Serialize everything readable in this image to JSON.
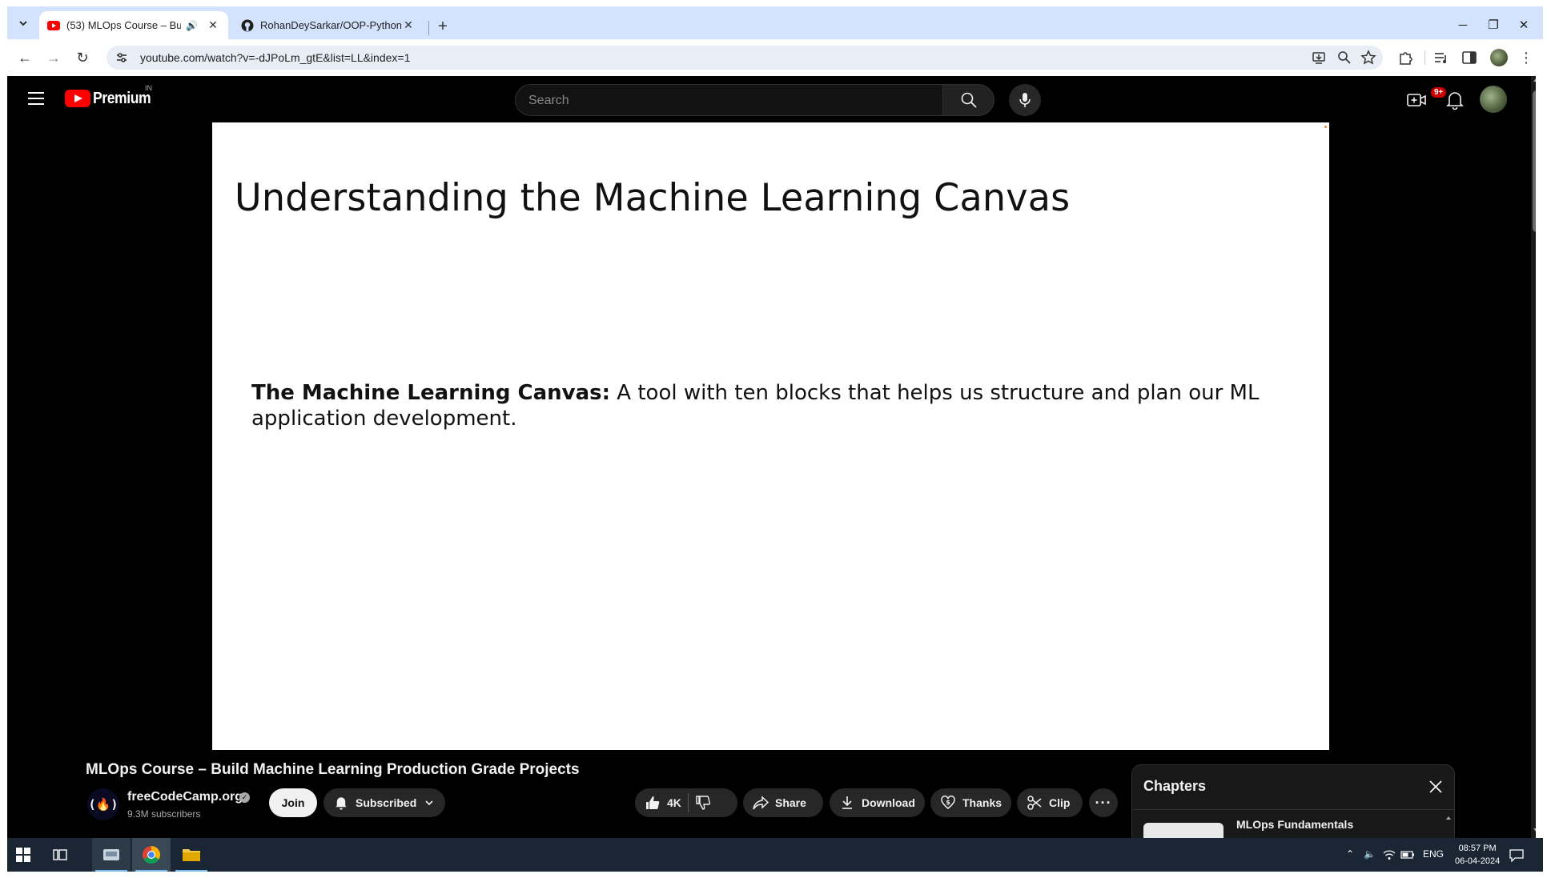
{
  "browser": {
    "tabs": [
      {
        "title": "(53) MLOps Course – Build Machine Learning Production Grade Projects",
        "active": true
      },
      {
        "title": "RohanDeySarkar/OOP-Python",
        "active": false
      }
    ],
    "url": "youtube.com/watch?v=-dJPoLm_gtE&list=LL&index=1"
  },
  "youtube": {
    "logo_text": "Premium",
    "region": "IN",
    "search_placeholder": "Search",
    "notification_badge": "9+",
    "video_title": "MLOps Course – Build Machine Learning Production Grade Projects",
    "channel": {
      "name": "freeCodeCamp.org",
      "subscribers": "9.3M subscribers",
      "logo_glyph": "(🔥)"
    },
    "buttons": {
      "join": "Join",
      "subscribed": "Subscribed",
      "likes": "4K",
      "share": "Share",
      "download": "Download",
      "thanks": "Thanks",
      "clip": "Clip"
    },
    "chapters": {
      "title": "Chapters",
      "items": [
        {
          "label": "MLOps Fundamentals"
        }
      ]
    }
  },
  "slide": {
    "title": "Understanding the Machine Learning Canvas",
    "body_bold": "The Machine Learning Canvas:",
    "body_text": " A tool with ten blocks that helps us structure and plan our ML application development."
  },
  "taskbar": {
    "language": "ENG",
    "time": "08:57 PM",
    "date": "06-04-2024"
  },
  "colors": {
    "tabstrip": "#d3e3fd",
    "youtube_red": "#ff0000",
    "background": "#000000"
  }
}
